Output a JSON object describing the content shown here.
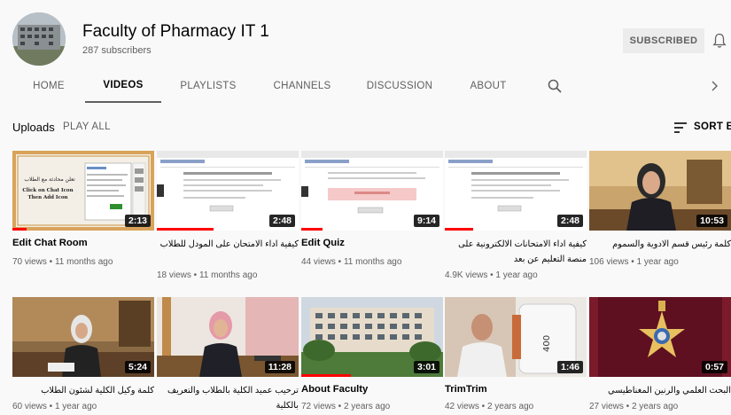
{
  "channel": {
    "name": "Faculty of Pharmacy IT 1",
    "subscribers": "287 subscribers",
    "subscribe_label": "SUBSCRIBED",
    "bell_icon": "bell-icon"
  },
  "tabs": [
    {
      "label": "HOME",
      "active": false
    },
    {
      "label": "VIDEOS",
      "active": true
    },
    {
      "label": "PLAYLISTS",
      "active": false
    },
    {
      "label": "CHANNELS",
      "active": false
    },
    {
      "label": "DISCUSSION",
      "active": false
    },
    {
      "label": "ABOUT",
      "active": false
    }
  ],
  "uploads": {
    "title": "Uploads",
    "play_all": "PLAY ALL",
    "sort_label": "SORT BY"
  },
  "videos": [
    {
      "title": "Edit Chat Room",
      "meta": "70 views • 11 months ago",
      "duration": "2:13",
      "rtl": false,
      "thumb_text": "تعلن محادثة مع الطلاب",
      "thumb_text2": "Click  on Chat Icon",
      "thumb_text3": "Then Add Icon",
      "watched": 0.1
    },
    {
      "title": "كيفية اداء الامتحان على المودل للطلاب",
      "meta": "18 views • 11 months ago",
      "duration": "2:48",
      "rtl": true,
      "watched": 0.4
    },
    {
      "title": "Edit Quiz",
      "meta": "44 views • 11 months ago",
      "duration": "9:14",
      "rtl": false,
      "watched": 0.15
    },
    {
      "title": "كيفية اداء الامتحانات الالكترونية على منصة التعليم عن بعد",
      "meta": "4.9K views • 1 year ago",
      "duration": "2:48",
      "rtl": true,
      "watched": 0.2
    },
    {
      "title": "كلمة رئيس قسم الادوية والسموم",
      "meta": "106 views • 1 year ago",
      "duration": "10:53",
      "rtl": true,
      "watched": 0
    },
    {
      "title": "كلمة وكيل الكلية لشئون الطلاب",
      "meta": "60 views • 1 year ago",
      "duration": "5:24",
      "rtl": true,
      "watched": 0
    },
    {
      "title": "ترحيب عميد الكلية بالطلاب والتعريف بالكلية",
      "meta": "",
      "duration": "11:28",
      "rtl": true,
      "watched": 0
    },
    {
      "title": "About Faculty",
      "meta": "72 views • 2 years ago",
      "duration": "3:01",
      "rtl": false,
      "watched": 0.35
    },
    {
      "title": "TrimTrim",
      "meta": "42 views • 2 years ago",
      "duration": "1:46",
      "rtl": false,
      "watched": 0
    },
    {
      "title": "البحث العلمي والرنين المغناطيسي",
      "meta": "27 views • 2 years ago",
      "duration": "0:57",
      "rtl": true,
      "watched": 0
    }
  ],
  "colors": {
    "accent_red": "#ff0000",
    "text_primary": "#030303",
    "text_secondary": "#606060",
    "background": "#f9f9f9"
  }
}
